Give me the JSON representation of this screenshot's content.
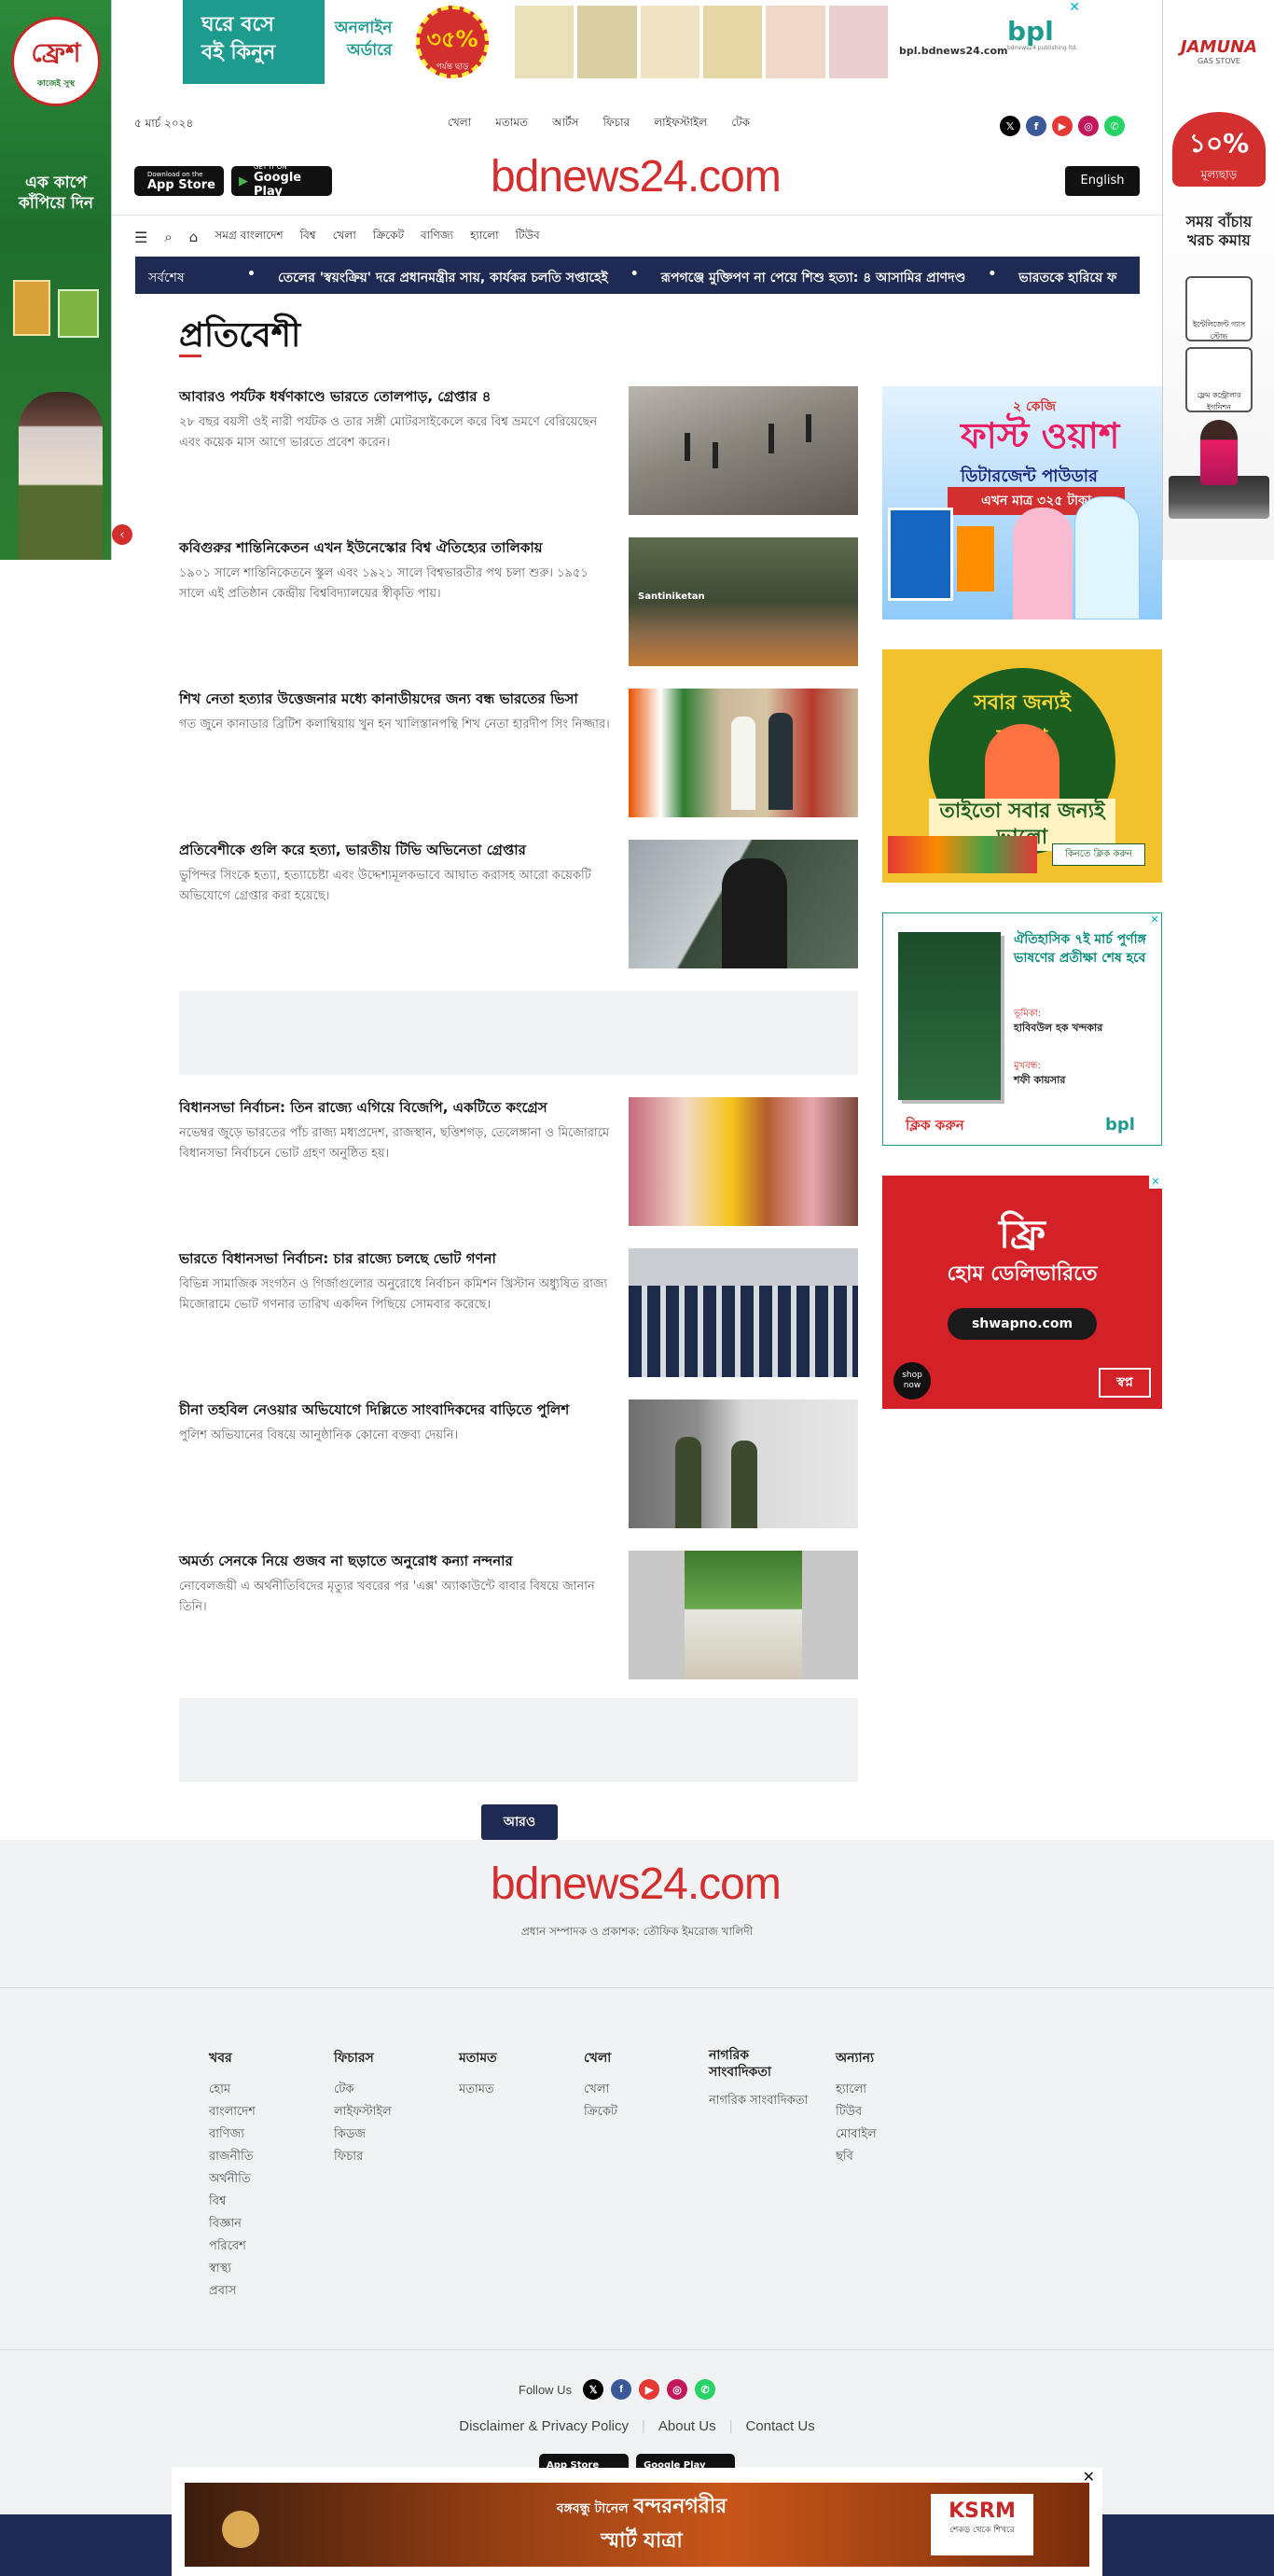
{
  "ads": {
    "left_sky": {
      "brand": "ফ্রেশ",
      "sub": "কাজেই সুস্থ",
      "tagline": "এক কাপে কাঁপিয়ে দিন"
    },
    "right_sky": {
      "brand": "JAMUNA",
      "sub": "GAS STOVE",
      "discount": "১০%",
      "discount_label": "মূল্যছাড়",
      "tagline": "সময় বাঁচায় খরচ কমায়",
      "item1": "ইন্টেলিজেন্ট গ্যাস স্টোভ",
      "item2": "ফ্লেম কন্ট্রোলার ইগনিশন"
    },
    "top": {
      "line1": "ঘরে বসে",
      "line2": "বই কিনুন",
      "online": "অনলাইন",
      "order": "অর্ডারে",
      "discount": "৩৫%",
      "discount_label": "পর্যন্ত ছাড়",
      "url": "bpl.bdnews24.com",
      "brand": "bpl",
      "brand_sub": "bdnews24 publishing ltd."
    },
    "side1": {
      "title": "ফাস্ট ওয়াশ",
      "sub": "ডিটারজেন্ট পাউডার",
      "price": "এখন মাত্র ৩২৫ টাকা",
      "badge": "২ কেজি"
    },
    "side2": {
      "title": "সবার জন্যই ভালো",
      "tag": "তাইতো সবার জন্যই ভালো",
      "cta": "কিনতে ক্লিক করুন"
    },
    "side3": {
      "title": "ঐতিহাসিক ৭ই মার্চ পুর্ণাঙ্গ ভাষণের প্রতীক্ষা শেষ হবে",
      "role1": "ভূমিকা:",
      "name1": "হাবিবউল হক খন্দকার",
      "role2": "মুখবন্ধ:",
      "name2": "শফী কায়সার",
      "cta": "ক্লিক করুন",
      "brand": "bpl"
    },
    "side4": {
      "title": "ফ্রি",
      "sub": "হোম ডেলিভারিতে",
      "url": "shwapno.com",
      "shop": "shop now",
      "brand": "স্বপ্ন"
    },
    "bottom": {
      "line1": "বঙ্গবন্ধু টানেল",
      "line2": "বন্দরনগরীর",
      "line3": "স্মার্ট যাত্রা",
      "brand": "KSRM",
      "brand_sub": "শেকড় থেকে শিখরে"
    }
  },
  "header": {
    "date": "৫ মার্চ ২০২৪",
    "top_nav": [
      "খেলা",
      "মতামত",
      "আর্টস",
      "ফিচার",
      "লাইফস্টাইল",
      "টেক"
    ],
    "app_store": {
      "small": "Download on the",
      "label": "App Store"
    },
    "google_play": {
      "small": "GET IT ON",
      "label": "Google Play"
    },
    "brand": "bdnews24.com",
    "lang_button": "English",
    "main_nav": [
      "সমগ্র বাংলাদেশ",
      "বিশ্ব",
      "খেলা",
      "ক্রিকেট",
      "বাণিজ্য",
      "হ্যালো",
      "টিউব"
    ]
  },
  "ticker": {
    "label": "সর্বশেষ",
    "items": [
      "তেলের 'স্বয়ংক্রিয়' দরে প্রধানমন্ত্রীর সায়, কার্যকর চলতি সপ্তাহেই",
      "রূপগঞ্জে মুক্তিপণ না পেয়ে শিশু হত্যা: ৪ আসামির প্রাণদণ্ড",
      "ভারতকে হারিয়ে ফ"
    ]
  },
  "section_title": "প্রতিবেশী",
  "articles": [
    {
      "title": "আবারও পর্যটক ধর্ষণকাণ্ডে ভারতে তোলপাড়, গ্রেপ্তার ৪",
      "summary": "২৮ বছর বয়সী ওই নারী পর্যটক ও তার সঙ্গী মোটরসাইকেলে করে বিশ্ব ভ্রমণে বেরিয়েছেন এবং কয়েক মাস আগে ভারতে প্রবেশ করেন।"
    },
    {
      "title": "কবিগুরুর শান্তিনিকেতন এখন ইউনেস্কোর বিশ্ব ঐতিহ্যের তালিকায়",
      "summary": "১৯০১ সালে শান্তিনিকেতনে স্কুল এবং ১৯২১ সালে বিশ্বভারতীর পথ চলা শুরু। ১৯৫১ সালে এই প্রতিষ্ঠান কেন্দ্রীয় বিশ্ববিদ্যালয়ের স্বীকৃতি পায়।",
      "thumb_label": "Santiniketan"
    },
    {
      "title": "শিখ নেতা হত্যার উত্তেজনার মধ্যে কানাডীয়দের জন্য বন্ধ ভারতের ভিসা",
      "summary": "গত জুনে কানাডার ব্রিটিশ কলাম্বিয়ায় খুন হন খালিস্তানপন্থি শিখ নেতা হারদীপ সিং নিজ্জার।"
    },
    {
      "title": "প্রতিবেশীকে গুলি করে হত্যা, ভারতীয় টিভি অভিনেতা গ্রেপ্তার",
      "summary": "ভুপিন্দর সিংকে হত্যা, হত্যাচেষ্টা এবং উদ্দেশ্যমূলকভাবে আঘাত করাসহ আরো কয়েকটি অভিযোগে গ্রেপ্তার করা হয়েছে।"
    },
    {
      "title": "বিধানসভা নির্বাচন: তিন রাজ্যে এগিয়ে বিজেপি, একটিতে কংগ্রেস",
      "summary": "নভেম্বর জুড়ে ভারতের পাঁচ রাজ্য মধ্যপ্রদেশ, রাজস্থান, ছত্তিশগড়, তেলেঙ্গানা ও মিজোরামে বিধানসভা নির্বাচনে ভোট গ্রহণ অনুষ্ঠিত হয়।"
    },
    {
      "title": "ভারতে বিধানসভা নির্বাচন: চার রাজ্যে চলছে ভোট গণনা",
      "summary": "বিভিন্ন সামাজিক সংগঠন ও গির্জাগুলোর অনুরোধে নির্বাচন কমিশন খ্রিস্টান অধ্যুষিত রাজ্য মিজোরামে ভোট গণনার তারিখ একদিন পিছিয়ে সোমবার করেছে।"
    },
    {
      "title": "চীনা তহবিল নেওয়ার অভিযোগে দিল্লিতে সাংবাদিকদের বাড়িতে পুলিশ",
      "summary": "পুলিশ অভিযানের বিষয়ে আনুষ্ঠানিক কোনো বক্তব্য দেয়নি।"
    },
    {
      "title": "অমর্ত্য সেনকে নিয়ে গুজব না ছড়াতে অনুরোধ কন্যা নন্দনার",
      "summary": "নোবেলজয়ী এ অর্থনীতিবিদের মৃত্যুর খবরের পর 'এক্স' অ্যাকাউন্টে বাবার বিষয়ে জানান তিনি।"
    }
  ],
  "more_button": "আরও",
  "footer": {
    "brand": "bdnews24.com",
    "editor_line": "প্রধান সম্পাদক ও প্রকাশক: তৌফিক ইমরোজ খালিদী",
    "columns": [
      {
        "title": "খবর",
        "items": [
          "হোম",
          "বাংলাদেশ",
          "বাণিজ্য",
          "রাজনীতি",
          "অর্থনীতি",
          "বিশ্ব",
          "বিজ্ঞান",
          "পরিবেশ",
          "স্বাস্থ্য",
          "প্রবাস"
        ]
      },
      {
        "title": "ফিচারস",
        "items": [
          "টেক",
          "লাইফস্টাইল",
          "কিডজ",
          "ফিচার"
        ]
      },
      {
        "title": "মতামত",
        "items": [
          "মতামত"
        ]
      },
      {
        "title": "খেলা",
        "items": [
          "খেলা",
          "ক্রিকেট"
        ]
      },
      {
        "title": "নাগরিক সাংবাদিকতা",
        "items": [
          "নাগরিক সাংবাদিকতা"
        ]
      },
      {
        "title": "অন্যান্য",
        "items": [
          "হ্যালো",
          "টিউব",
          "মোবাইল",
          "ছবি"
        ]
      }
    ],
    "follow_label": "Follow Us",
    "links": [
      "Disclaimer & Privacy Policy",
      "About Us",
      "Contact Us"
    ]
  },
  "colors": {
    "brand_red": "#d32f2f",
    "navy": "#1e2a52",
    "gray_bg": "#f1f2f4"
  }
}
